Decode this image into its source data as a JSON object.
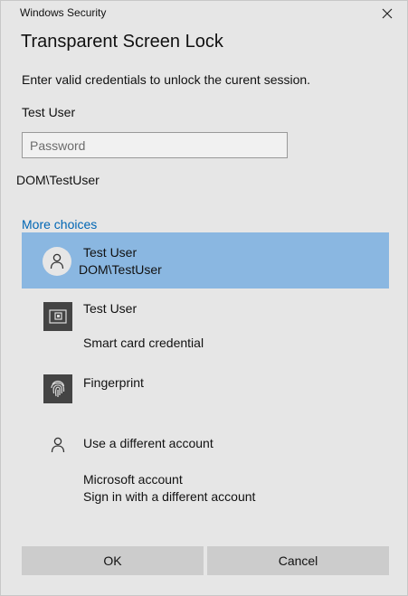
{
  "window": {
    "title": "Windows Security"
  },
  "dialog": {
    "title": "Transparent Screen Lock",
    "instruction": "Enter valid credentials to unlock the curent session.",
    "username": "Test User",
    "password_placeholder": "Password",
    "password_value": "",
    "domain": "DOM\\TestUser",
    "more_choices": "More choices"
  },
  "choices": [
    {
      "icon": "user-avatar-icon",
      "line1": "Test User",
      "line2": "DOM\\TestUser",
      "selected": true
    },
    {
      "icon": "smart-card-icon",
      "line1": "Test User",
      "line2": "Smart card credential",
      "selected": false
    },
    {
      "icon": "fingerprint-icon",
      "line1": "Fingerprint",
      "selected": false
    },
    {
      "icon": "person-icon",
      "line1": "Use a different account",
      "selected": false
    },
    {
      "icon": "none",
      "line1": "Microsoft account",
      "line2": "Sign in with a different account",
      "selected": false
    }
  ],
  "buttons": {
    "ok": "OK",
    "cancel": "Cancel"
  },
  "colors": {
    "background": "#e6e6e6",
    "selected": "#8ab7e1",
    "link": "#0066b4",
    "button": "#cccccc",
    "icon_box": "#444444"
  }
}
